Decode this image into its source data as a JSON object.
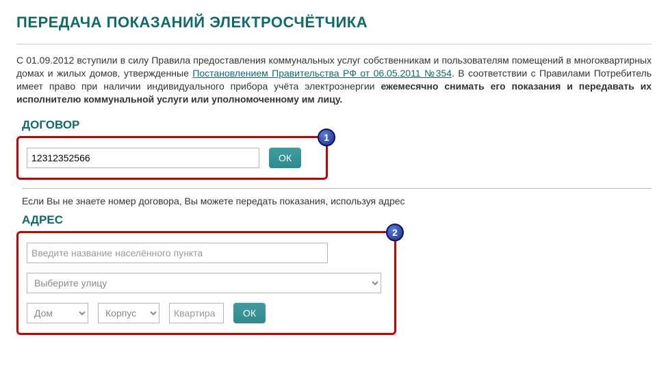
{
  "page_title": "ПЕРЕДАЧА ПОКАЗАНИЙ ЭЛЕКТРОСЧЁТЧИКА",
  "intro": {
    "part1": "С 01.09.2012 вступили в силу Правила предоставления коммунальных услуг собственникам и пользователям помещений в многоквартирных домах и жилых домов, утвержденные ",
    "link": "Постановлением Правительства РФ от 06.05.2011 №354",
    "part2": ". В соответствии с Правилами Потребитель имеет право при наличии индивидуального прибора учёта электроэнергии ",
    "bold": "ежемесячно снимать его показания и передавать их исполнителю коммунальной услуги или уполномоченному им лицу."
  },
  "contract": {
    "heading": "ДОГОВОР",
    "badge": "1",
    "value": "12312352566",
    "ok_label": "ОК"
  },
  "hint_text": "Если Вы не знаете номер договора, Вы можете передать показания, используя адрес",
  "address": {
    "heading": "АДРЕС",
    "badge": "2",
    "locality_placeholder": "Введите название населённого пункта",
    "street_placeholder": "Выберите улицу",
    "house_placeholder": "Дом",
    "building_placeholder": "Корпус",
    "apartment_placeholder": "Квартира",
    "ok_label": "ОК"
  }
}
